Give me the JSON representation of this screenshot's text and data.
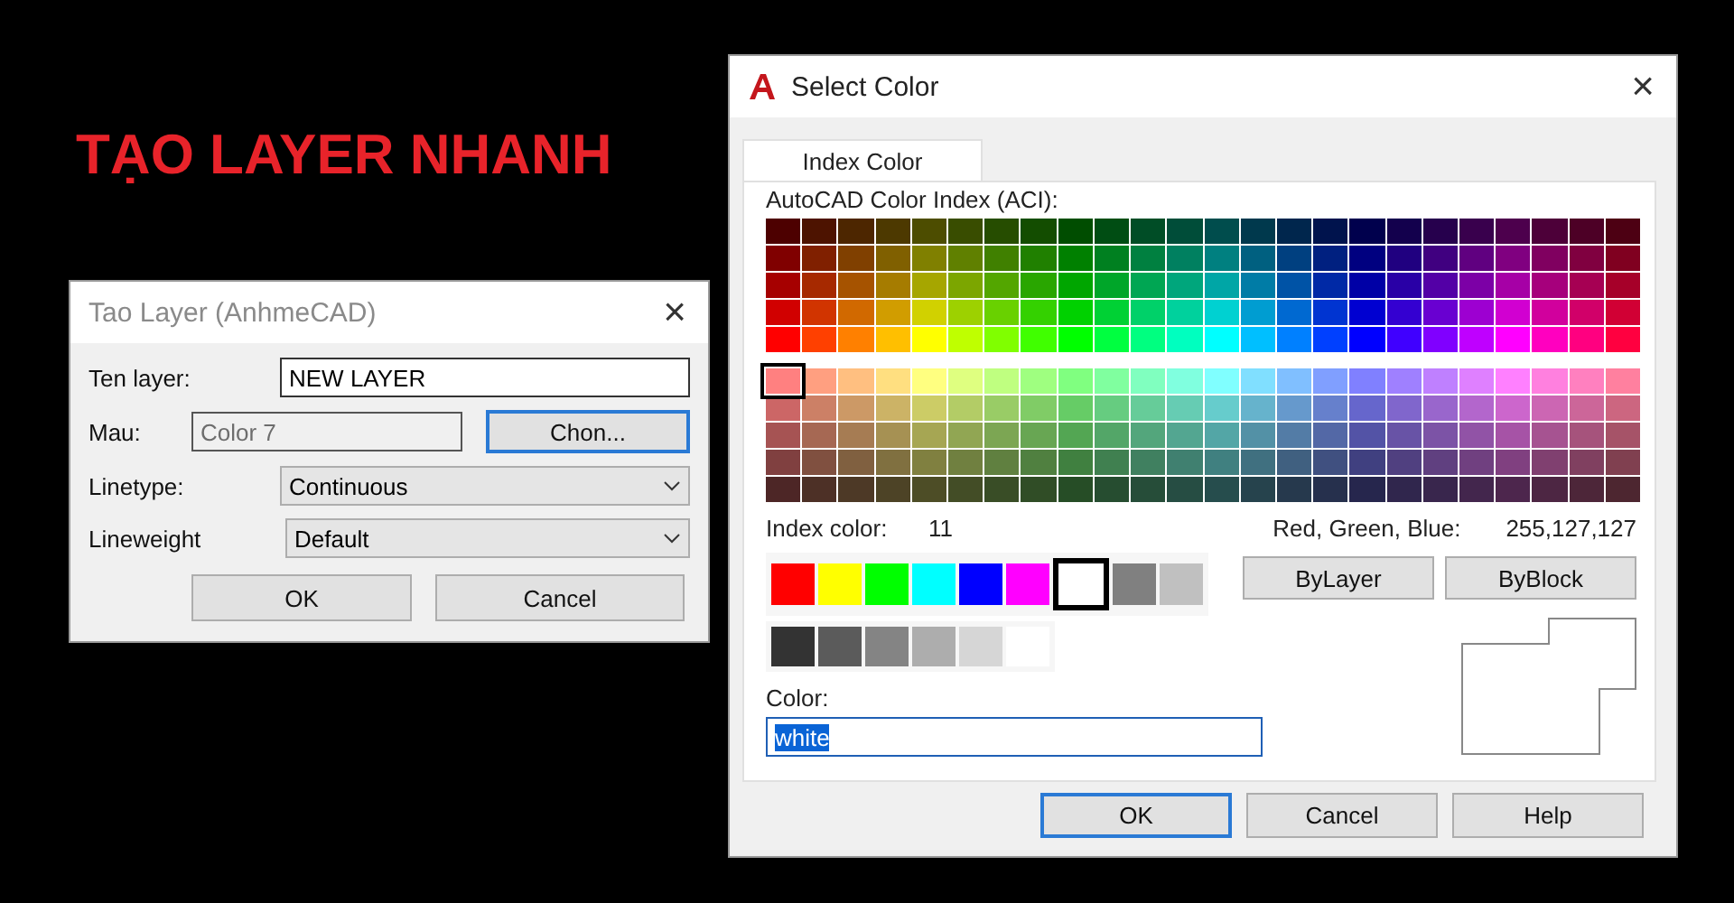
{
  "headline": "TẠO LAYER NHANH",
  "layer_dialog": {
    "title": "Tao Layer (AnhmeCAD)",
    "close": "×",
    "name_label": "Ten layer:",
    "name_value": "NEW LAYER",
    "color_label": "Mau:",
    "color_value": "Color 7",
    "choose_button": {
      "label": "Chon...",
      "focused": true
    },
    "linetype_label": "Linetype:",
    "linetype_value": "Continuous",
    "lineweight_label": "Lineweight",
    "lineweight_value": "Default",
    "buttons": [
      {
        "label": "OK",
        "focused": false
      },
      {
        "label": "Cancel",
        "focused": false
      }
    ]
  },
  "select_color_dialog": {
    "title": "Select Color",
    "close": "×",
    "tabs": [
      {
        "label": "Index Color",
        "selected": true
      }
    ],
    "palette_label": "AutoCAD Color Index (ACI):",
    "palette": {
      "rows": [
        {
          "cells": [
            {
              "selected": false
            },
            {
              "selected": false
            },
            {
              "selected": false
            },
            {
              "selected": false
            },
            {
              "selected": false
            },
            {
              "selected": false
            },
            {
              "selected": false
            },
            {
              "selected": false
            },
            {
              "selected": false
            },
            {
              "selected": false
            },
            {
              "selected": false
            },
            {
              "selected": false
            },
            {
              "selected": false
            },
            {
              "selected": false
            },
            {
              "selected": false
            },
            {
              "selected": false
            },
            {
              "selected": false
            },
            {
              "selected": false
            },
            {
              "selected": false
            },
            {
              "selected": false
            },
            {
              "selected": false
            },
            {
              "selected": false
            },
            {
              "selected": false
            },
            {
              "selected": false
            }
          ]
        },
        {
          "cells": [
            {
              "selected": false
            },
            {
              "selected": false
            },
            {
              "selected": false
            },
            {
              "selected": false
            },
            {
              "selected": false
            },
            {
              "selected": false
            },
            {
              "selected": false
            },
            {
              "selected": false
            },
            {
              "selected": false
            },
            {
              "selected": false
            },
            {
              "selected": false
            },
            {
              "selected": false
            },
            {
              "selected": false
            },
            {
              "selected": false
            },
            {
              "selected": false
            },
            {
              "selected": false
            },
            {
              "selected": false
            },
            {
              "selected": false
            },
            {
              "selected": false
            },
            {
              "selected": false
            },
            {
              "selected": false
            },
            {
              "selected": false
            },
            {
              "selected": false
            },
            {
              "selected": false
            }
          ]
        },
        {
          "cells": [
            {
              "selected": false
            },
            {
              "selected": false
            },
            {
              "selected": false
            },
            {
              "selected": false
            },
            {
              "selected": false
            },
            {
              "selected": false
            },
            {
              "selected": false
            },
            {
              "selected": false
            },
            {
              "selected": false
            },
            {
              "selected": false
            },
            {
              "selected": false
            },
            {
              "selected": false
            },
            {
              "selected": false
            },
            {
              "selected": false
            },
            {
              "selected": false
            },
            {
              "selected": false
            },
            {
              "selected": false
            },
            {
              "selected": false
            },
            {
              "selected": false
            },
            {
              "selected": false
            },
            {
              "selected": false
            },
            {
              "selected": false
            },
            {
              "selected": false
            },
            {
              "selected": false
            }
          ]
        },
        {
          "cells": [
            {
              "selected": false
            },
            {
              "selected": false
            },
            {
              "selected": false
            },
            {
              "selected": false
            },
            {
              "selected": false
            },
            {
              "selected": false
            },
            {
              "selected": false
            },
            {
              "selected": false
            },
            {
              "selected": false
            },
            {
              "selected": false
            },
            {
              "selected": false
            },
            {
              "selected": false
            },
            {
              "selected": false
            },
            {
              "selected": false
            },
            {
              "selected": false
            },
            {
              "selected": false
            },
            {
              "selected": false
            },
            {
              "selected": false
            },
            {
              "selected": false
            },
            {
              "selected": false
            },
            {
              "selected": false
            },
            {
              "selected": false
            },
            {
              "selected": false
            },
            {
              "selected": false
            }
          ]
        },
        {
          "cells": [
            {
              "selected": false
            },
            {
              "selected": false
            },
            {
              "selected": false
            },
            {
              "selected": false
            },
            {
              "selected": false
            },
            {
              "selected": false
            },
            {
              "selected": false
            },
            {
              "selected": false
            },
            {
              "selected": false
            },
            {
              "selected": false
            },
            {
              "selected": false
            },
            {
              "selected": false
            },
            {
              "selected": false
            },
            {
              "selected": false
            },
            {
              "selected": false
            },
            {
              "selected": false
            },
            {
              "selected": false
            },
            {
              "selected": false
            },
            {
              "selected": false
            },
            {
              "selected": false
            },
            {
              "selected": false
            },
            {
              "selected": false
            },
            {
              "selected": false
            },
            {
              "selected": false
            }
          ]
        },
        {
          "cells": [
            {
              "selected": true
            },
            {
              "selected": false
            },
            {
              "selected": false
            },
            {
              "selected": false
            },
            {
              "selected": false
            },
            {
              "selected": false
            },
            {
              "selected": false
            },
            {
              "selected": false
            },
            {
              "selected": false
            },
            {
              "selected": false
            },
            {
              "selected": false
            },
            {
              "selected": false
            },
            {
              "selected": false
            },
            {
              "selected": false
            },
            {
              "selected": false
            },
            {
              "selected": false
            },
            {
              "selected": false
            },
            {
              "selected": false
            },
            {
              "selected": false
            },
            {
              "selected": false
            },
            {
              "selected": false
            },
            {
              "selected": false
            },
            {
              "selected": false
            },
            {
              "selected": false
            }
          ]
        },
        {
          "cells": [
            {
              "selected": false
            },
            {
              "selected": false
            },
            {
              "selected": false
            },
            {
              "selected": false
            },
            {
              "selected": false
            },
            {
              "selected": false
            },
            {
              "selected": false
            },
            {
              "selected": false
            },
            {
              "selected": false
            },
            {
              "selected": false
            },
            {
              "selected": false
            },
            {
              "selected": false
            },
            {
              "selected": false
            },
            {
              "selected": false
            },
            {
              "selected": false
            },
            {
              "selected": false
            },
            {
              "selected": false
            },
            {
              "selected": false
            },
            {
              "selected": false
            },
            {
              "selected": false
            },
            {
              "selected": false
            },
            {
              "selected": false
            },
            {
              "selected": false
            },
            {
              "selected": false
            }
          ]
        },
        {
          "cells": [
            {
              "selected": false
            },
            {
              "selected": false
            },
            {
              "selected": false
            },
            {
              "selected": false
            },
            {
              "selected": false
            },
            {
              "selected": false
            },
            {
              "selected": false
            },
            {
              "selected": false
            },
            {
              "selected": false
            },
            {
              "selected": false
            },
            {
              "selected": false
            },
            {
              "selected": false
            },
            {
              "selected": false
            },
            {
              "selected": false
            },
            {
              "selected": false
            },
            {
              "selected": false
            },
            {
              "selected": false
            },
            {
              "selected": false
            },
            {
              "selected": false
            },
            {
              "selected": false
            },
            {
              "selected": false
            },
            {
              "selected": false
            },
            {
              "selected": false
            },
            {
              "selected": false
            }
          ]
        },
        {
          "cells": [
            {
              "selected": false
            },
            {
              "selected": false
            },
            {
              "selected": false
            },
            {
              "selected": false
            },
            {
              "selected": false
            },
            {
              "selected": false
            },
            {
              "selected": false
            },
            {
              "selected": false
            },
            {
              "selected": false
            },
            {
              "selected": false
            },
            {
              "selected": false
            },
            {
              "selected": false
            },
            {
              "selected": false
            },
            {
              "selected": false
            },
            {
              "selected": false
            },
            {
              "selected": false
            },
            {
              "selected": false
            },
            {
              "selected": false
            },
            {
              "selected": false
            },
            {
              "selected": false
            },
            {
              "selected": false
            },
            {
              "selected": false
            },
            {
              "selected": false
            },
            {
              "selected": false
            }
          ]
        },
        {
          "cells": [
            {
              "selected": false
            },
            {
              "selected": false
            },
            {
              "selected": false
            },
            {
              "selected": false
            },
            {
              "selected": false
            },
            {
              "selected": false
            },
            {
              "selected": false
            },
            {
              "selected": false
            },
            {
              "selected": false
            },
            {
              "selected": false
            },
            {
              "selected": false
            },
            {
              "selected": false
            },
            {
              "selected": false
            },
            {
              "selected": false
            },
            {
              "selected": false
            },
            {
              "selected": false
            },
            {
              "selected": false
            },
            {
              "selected": false
            },
            {
              "selected": false
            },
            {
              "selected": false
            },
            {
              "selected": false
            },
            {
              "selected": false
            },
            {
              "selected": false
            },
            {
              "selected": false
            }
          ]
        }
      ]
    },
    "index_color_label": "Index color:",
    "index_color_value": "11",
    "rgb_label": "Red, Green, Blue:",
    "rgb_value": "255,127,127",
    "standard_colors": [
      {
        "color": "#ff0000",
        "selected": false
      },
      {
        "color": "#ffff00",
        "selected": false
      },
      {
        "color": "#00ff00",
        "selected": false
      },
      {
        "color": "#00ffff",
        "selected": false
      },
      {
        "color": "#0000ff",
        "selected": false
      },
      {
        "color": "#ff00ff",
        "selected": false
      },
      {
        "color": "#ffffff",
        "selected": true
      },
      {
        "color": "#808080",
        "selected": false
      },
      {
        "color": "#c0c0c0",
        "selected": false
      }
    ],
    "gray_colors": [
      {
        "color": "#333333",
        "selected": false
      },
      {
        "color": "#5b5b5b",
        "selected": false
      },
      {
        "color": "#848484",
        "selected": false
      },
      {
        "color": "#adadad",
        "selected": false
      },
      {
        "color": "#d6d6d6",
        "selected": false
      },
      {
        "color": "#ffffff",
        "selected": false
      }
    ],
    "side_buttons": [
      "ByLayer",
      "ByBlock"
    ],
    "color_field_label": "Color:",
    "color_field_value": "white",
    "buttons": [
      {
        "label": "OK",
        "focused": true
      },
      {
        "label": "Cancel",
        "focused": false
      },
      {
        "label": "Help",
        "focused": false
      }
    ]
  }
}
